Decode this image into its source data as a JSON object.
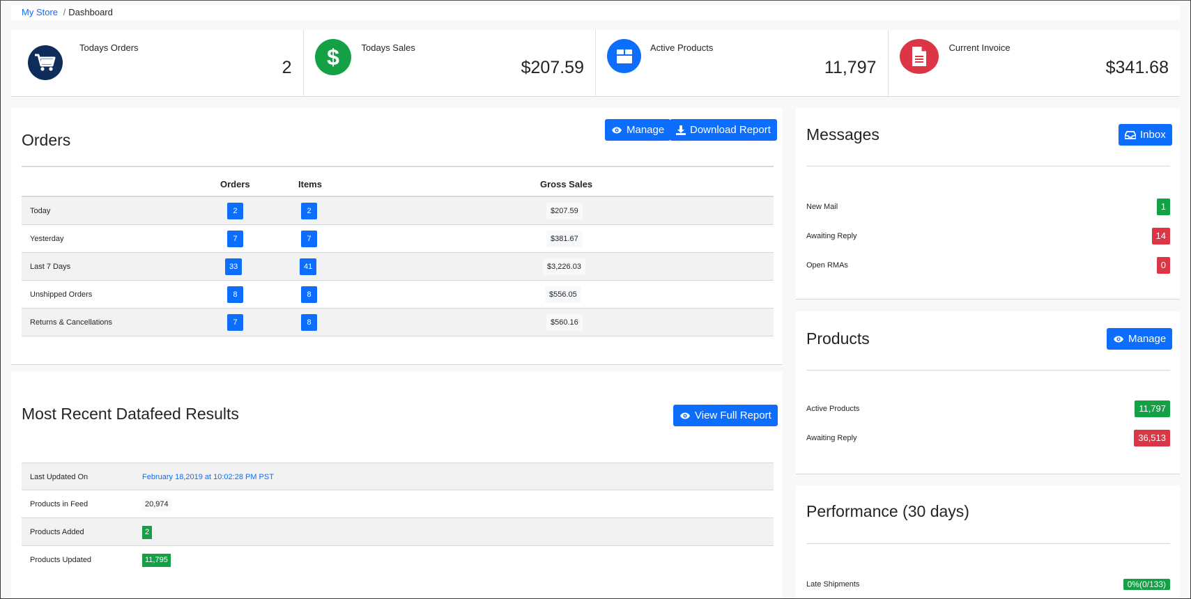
{
  "breadcrumb": {
    "store": "My Store",
    "separator": "/",
    "current": "Dashboard"
  },
  "stats": [
    {
      "label": "Todays Orders",
      "value": "2",
      "icon": "cart-icon",
      "color": "#0f2d5a"
    },
    {
      "label": "Todays Sales",
      "value": "$207.59",
      "icon": "dollar-icon",
      "color": "#14a044"
    },
    {
      "label": "Active Products",
      "value": "11,797",
      "icon": "box-icon",
      "color": "#0d6efd"
    },
    {
      "label": "Current Invoice",
      "value": "$341.68",
      "icon": "document-icon",
      "color": "#dc3545"
    }
  ],
  "orders": {
    "title": "Orders",
    "manage_label": "Manage",
    "download_label": "Download Report",
    "columns": [
      "Orders",
      "Items",
      "Gross Sales"
    ],
    "rows": [
      {
        "label": "Today",
        "orders": "2",
        "items": "2",
        "gross": "$207.59"
      },
      {
        "label": "Yesterday",
        "orders": "7",
        "items": "7",
        "gross": "$381.67"
      },
      {
        "label": "Last 7 Days",
        "orders": "33",
        "items": "41",
        "gross": "$3,226.03"
      },
      {
        "label": "Unshipped Orders",
        "orders": "8",
        "items": "8",
        "gross": "$556.05"
      },
      {
        "label": "Returns & Cancellations",
        "orders": "7",
        "items": "8",
        "gross": "$560.16"
      }
    ]
  },
  "datafeed": {
    "title": "Most Recent Datafeed Results",
    "view_label": "View Full Report",
    "rows": [
      {
        "label": "Last Updated On",
        "value": "February 18,2019 at 10:02:28 PM PST",
        "style": "link"
      },
      {
        "label": "Products in Feed",
        "value": "20,974",
        "style": "light"
      },
      {
        "label": "Products Added",
        "value": "2",
        "style": "green"
      },
      {
        "label": "Products Updated",
        "value": "11,795",
        "style": "green"
      }
    ]
  },
  "messages": {
    "title": "Messages",
    "inbox_label": "Inbox",
    "items": [
      {
        "label": "New Mail",
        "value": "1",
        "color": "green"
      },
      {
        "label": "Awaiting Reply",
        "value": "14",
        "color": "red"
      },
      {
        "label": "Open RMAs",
        "value": "0",
        "color": "red"
      }
    ]
  },
  "products": {
    "title": "Products",
    "manage_label": "Manage",
    "items": [
      {
        "label": "Active Products",
        "value": "11,797",
        "color": "green"
      },
      {
        "label": "Awaiting Reply",
        "value": "36,513",
        "color": "red"
      }
    ]
  },
  "performance": {
    "title": "Performance (30 days)",
    "items": [
      {
        "label": "Late Shipments",
        "value": "0%(0/133)",
        "color": "green"
      }
    ]
  }
}
